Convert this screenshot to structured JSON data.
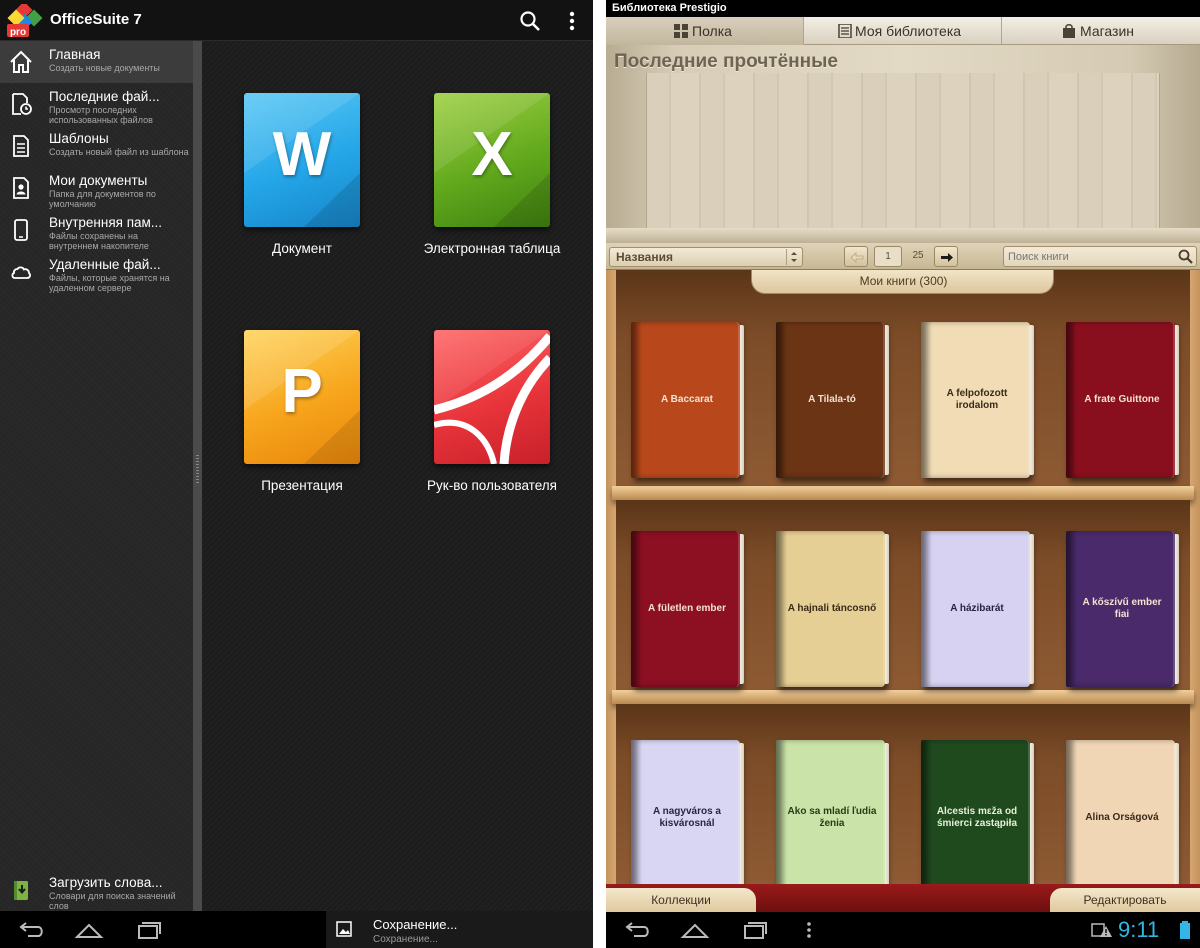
{
  "officesuite": {
    "app_title": "OfficeSuite 7",
    "logo_badge": "pro",
    "drawer": [
      {
        "title": "Главная",
        "subtitle": "Создать новые документы",
        "icon": "home-icon"
      },
      {
        "title": "Последние фай...",
        "subtitle": "Просмотр последних использованных файлов",
        "icon": "recent-files-icon"
      },
      {
        "title": "Шаблоны",
        "subtitle": "Создать новый файл из шаблона",
        "icon": "template-icon"
      },
      {
        "title": "Мои документы",
        "subtitle": "Папка для документов по умолчанию",
        "icon": "my-documents-icon"
      },
      {
        "title": "Внутренняя пам...",
        "subtitle": "Файлы сохранены на внутреннем накопителе",
        "icon": "device-icon"
      },
      {
        "title": "Удаленные фай...",
        "subtitle": "Файлы, которые хранятся на удаленном сервере",
        "icon": "cloud-icon"
      }
    ],
    "drawer_bottom": {
      "title": "Загрузить слова...",
      "subtitle": "Словари для поиска значений слов",
      "icon": "download-dictionary-icon"
    },
    "tiles": [
      {
        "letter": "W",
        "label": "Документ",
        "color": "#1e9fe0"
      },
      {
        "letter": "X",
        "label": "Электронная таблица",
        "color": "#5aa51b"
      },
      {
        "letter": "P",
        "label": "Презентация",
        "color": "#f5a318"
      },
      {
        "letter": "",
        "label": "Рук-во пользователя",
        "color": "#e8343a"
      }
    ],
    "toast": {
      "title": "Сохранение...",
      "subtitle": "Сохранение..."
    }
  },
  "prestigio": {
    "app_title": "Библиотека Prestigio",
    "tabs": [
      {
        "label": "Полка",
        "icon": "grid-icon"
      },
      {
        "label": "Моя библиотека",
        "icon": "book-list-icon"
      },
      {
        "label": "Магазин",
        "icon": "shopping-bag-icon"
      }
    ],
    "recent_title": "Последние прочтённые",
    "sort_label": "Названия",
    "page_current": "1",
    "page_total": "25",
    "search_placeholder": "Поиск книги",
    "my_books_label": "Мои книги (300)",
    "books": [
      {
        "title": "A Baccarat",
        "color": "#b8481c",
        "text_color": "#f3e2cf"
      },
      {
        "title": "A Tilala-tó",
        "color": "#6b3415",
        "text_color": "#f3e2cf"
      },
      {
        "title": "A felpofozott irodalom",
        "color": "#f1dcb6",
        "text_color": "#3a2a1a"
      },
      {
        "title": "A frate Guittone",
        "color": "#8a0f1e",
        "text_color": "#f3e2cf"
      },
      {
        "title": "A fületlen ember",
        "color": "#8c0f22",
        "text_color": "#f3e2cf"
      },
      {
        "title": "A hajnali táncosnő",
        "color": "#e6cf94",
        "text_color": "#3a2a1a"
      },
      {
        "title": "A házibarát",
        "color": "#d8d2f2",
        "text_color": "#2a2440"
      },
      {
        "title": "A kőszívű ember fiai",
        "color": "#4a2a6a",
        "text_color": "#f3e2cf"
      },
      {
        "title": "A nagyváros a kisvárosnál",
        "color": "#d9d6f4",
        "text_color": "#2a2440"
      },
      {
        "title": "Ako sa mladí ľudia ženia",
        "color": "#c9e3a8",
        "text_color": "#2a3a1a"
      },
      {
        "title": "Alcestis mεža od śmierci zastąpiła",
        "color": "#1f4a1e",
        "text_color": "#e8efd8"
      },
      {
        "title": "Alina Orságová",
        "color": "#f1d6b6",
        "text_color": "#3a2a1a"
      }
    ],
    "collections_label": "Коллекции",
    "edit_label": "Редактировать",
    "clock": "9:11"
  }
}
